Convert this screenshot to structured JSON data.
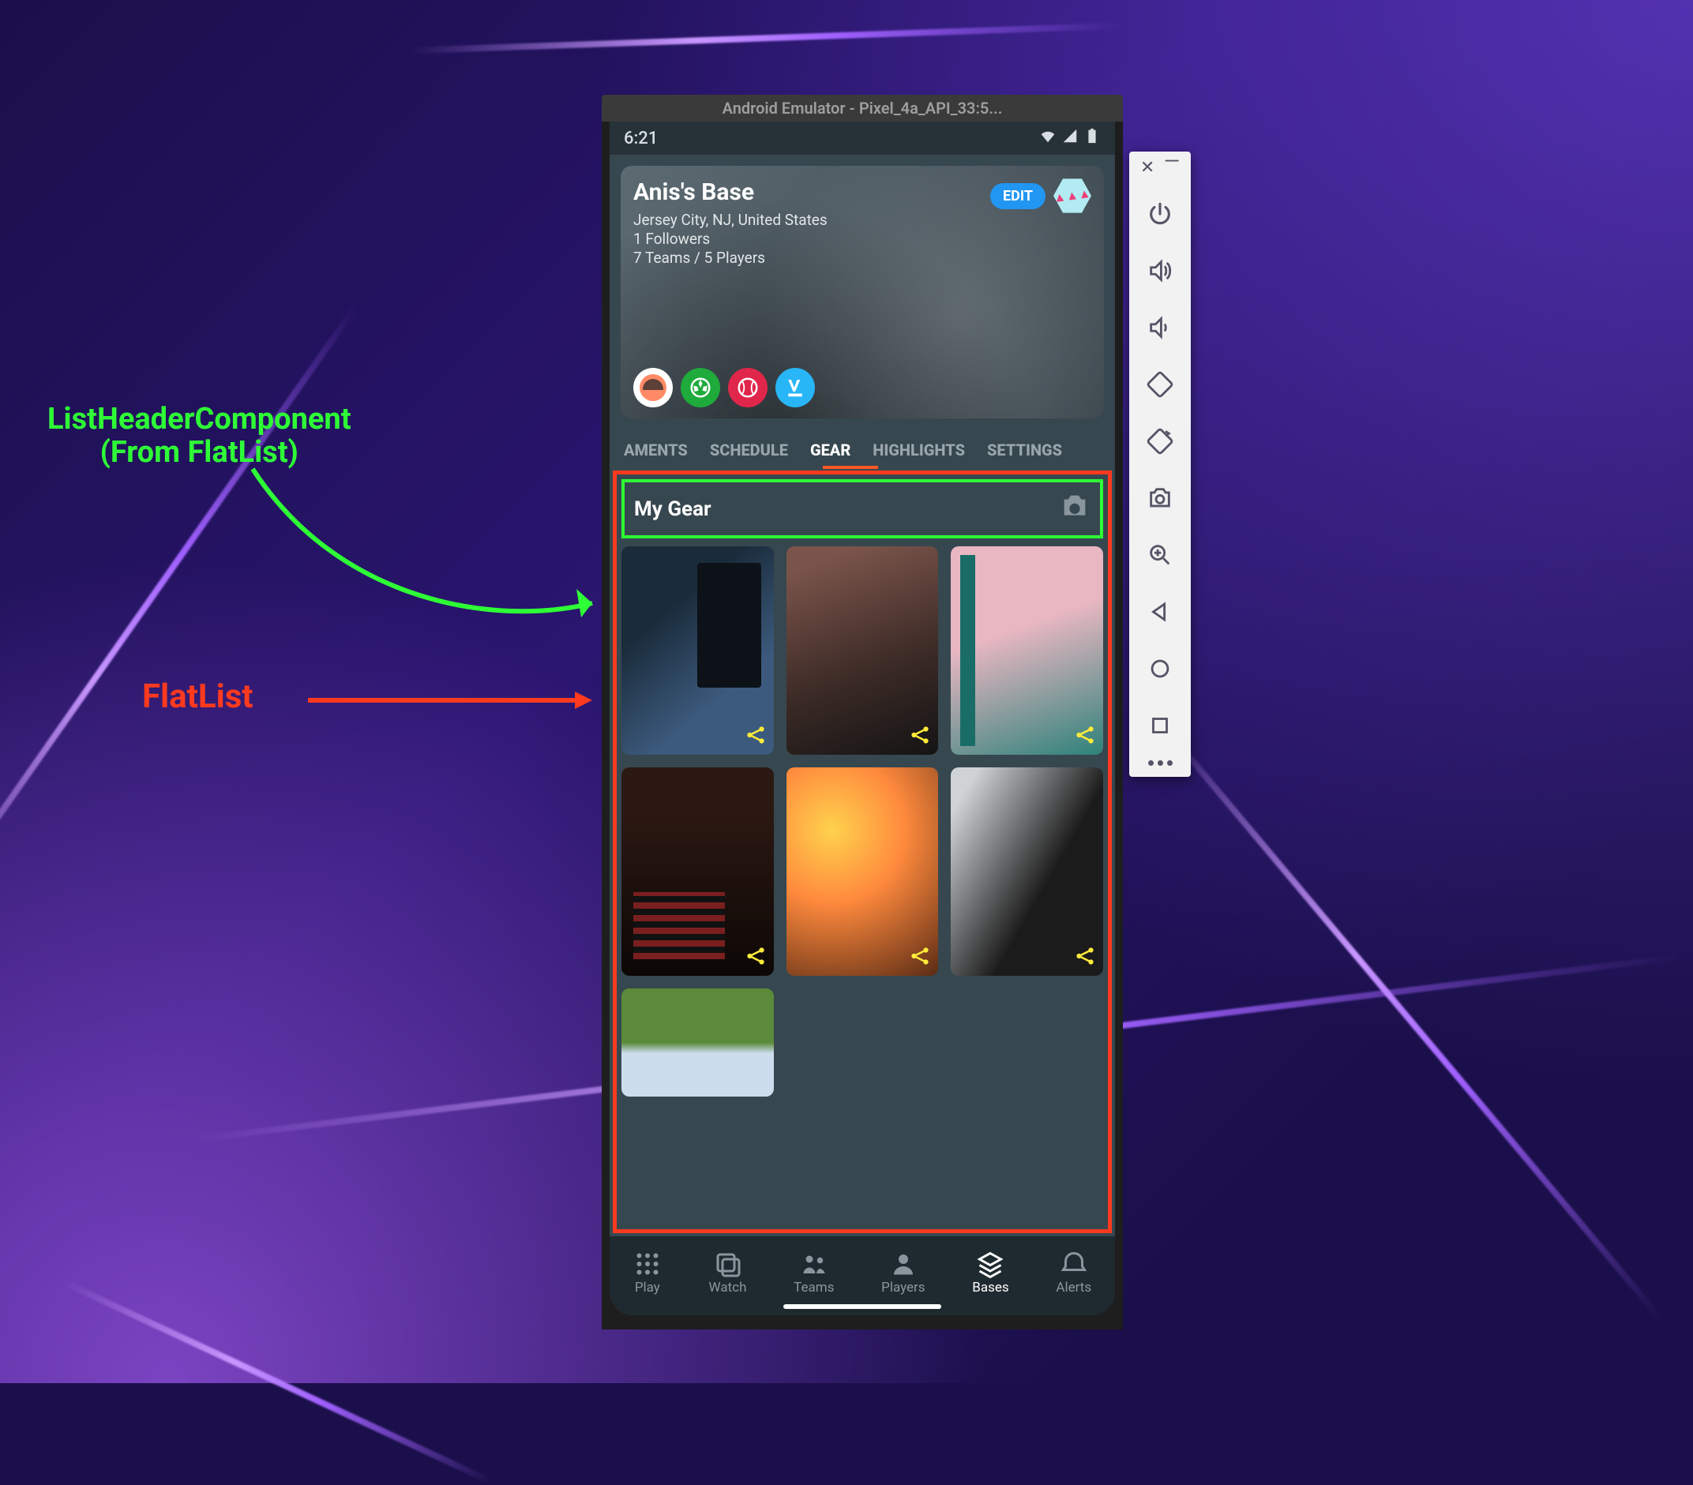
{
  "annotations": {
    "listheader_line1": "ListHeaderComponent",
    "listheader_line2": "(From FlatList)",
    "flatlist": "FlatList"
  },
  "emulator": {
    "title": "Android Emulator - Pixel_4a_API_33:5..."
  },
  "statusbar": {
    "time": "6:21"
  },
  "profile": {
    "title": "Anis's Base",
    "location": "Jersey City, NJ, United States",
    "followers": "1 Followers",
    "teams_players": "7 Teams / 5 Players",
    "edit_label": "EDIT"
  },
  "tabs": {
    "t1": "AMENTS",
    "t2": "SCHEDULE",
    "t3": "GEAR",
    "t4": "HIGHLIGHTS",
    "t5": "SETTINGS"
  },
  "list": {
    "header": "My Gear"
  },
  "bottom": {
    "play": "Play",
    "watch": "Watch",
    "teams": "Teams",
    "players": "Players",
    "bases": "Bases",
    "alerts": "Alerts"
  }
}
